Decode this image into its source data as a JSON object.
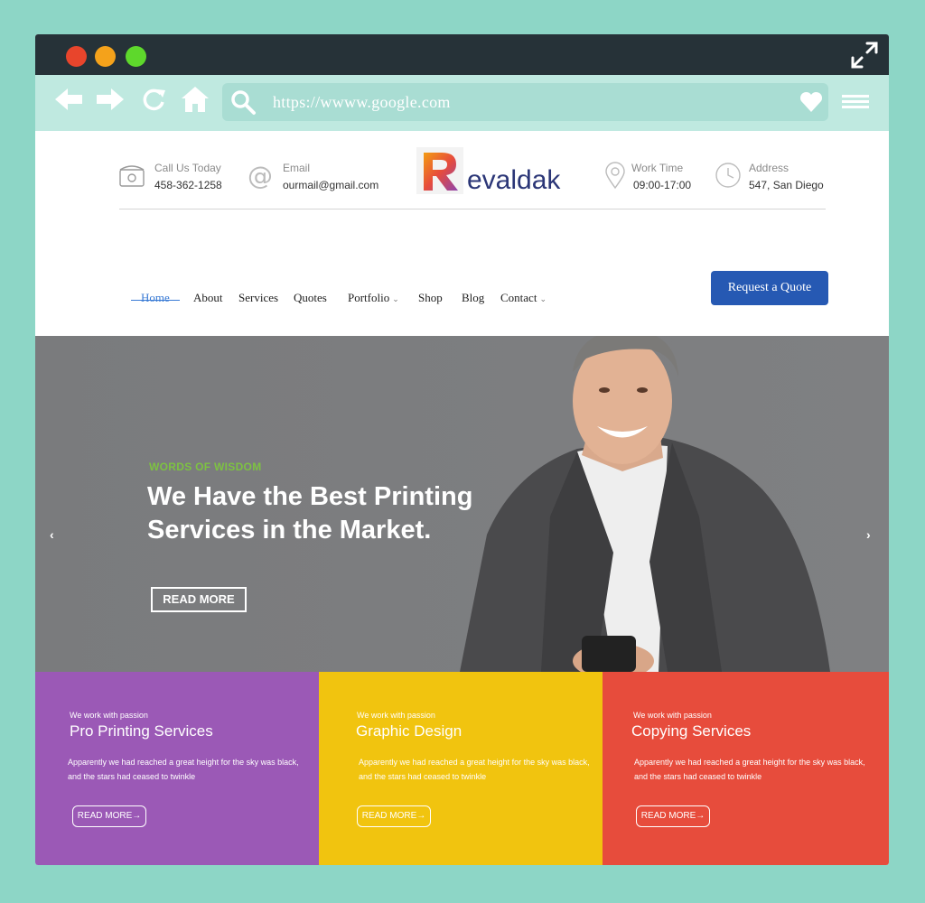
{
  "browser": {
    "url": "https://wwww.google.com",
    "icons": [
      "back-arrow-icon",
      "forward-arrow-icon",
      "reload-icon",
      "home-icon",
      "search-icon",
      "heart-icon",
      "hamburger-menu-icon",
      "expand-icon"
    ],
    "colors": {
      "titlebar": "#263238",
      "navbar": "#bfe9e0",
      "background": "#8dd6c6"
    }
  },
  "header": {
    "call": {
      "label": "Call Us Today",
      "value": "458-362-1258"
    },
    "email": {
      "label": "Email",
      "value": "ourmail@gmail.com"
    },
    "logo_text": "evaldak",
    "work_time": {
      "label": "Work Time",
      "value": "09:00-17:00"
    },
    "address": {
      "label": "Address",
      "value": "547, San Diego"
    }
  },
  "nav": {
    "items": [
      {
        "label": "Home",
        "active": true
      },
      {
        "label": "About"
      },
      {
        "label": "Services"
      },
      {
        "label": "Quotes"
      },
      {
        "label": "Portfolio",
        "dropdown": true
      },
      {
        "label": "Shop"
      },
      {
        "label": "Blog"
      },
      {
        "label": "Contact",
        "dropdown": true
      }
    ],
    "cta": "Request a Quote",
    "accent": "#3a7bd5",
    "cta_color": "#2659b3"
  },
  "hero": {
    "eyebrow": "WORDS OF WISDOM",
    "title": "We Have the Best Printing Services in the Market.",
    "button": "READ MORE",
    "eyebrow_color": "#7dc242"
  },
  "features": [
    {
      "kicker": "We work with passion",
      "title": "Pro Printing Services",
      "text": "Apparently we had reached a great height for the sky was black, and the stars had ceased to twinkle",
      "button": "READ MORE→",
      "color": "#9b59b6"
    },
    {
      "kicker": "We work with passion",
      "title": "Graphic Design",
      "text": "Apparently we had reached a great height for the sky was black, and the stars had ceased to twinkle",
      "button": "READ MORE→",
      "color": "#f1c40f"
    },
    {
      "kicker": "We work with passion",
      "title": "Copying Services",
      "text": "Apparently we had reached a great height for the sky was black, and the stars had ceased to twinkle",
      "button": "READ MORE→",
      "color": "#e74c3c"
    }
  ]
}
